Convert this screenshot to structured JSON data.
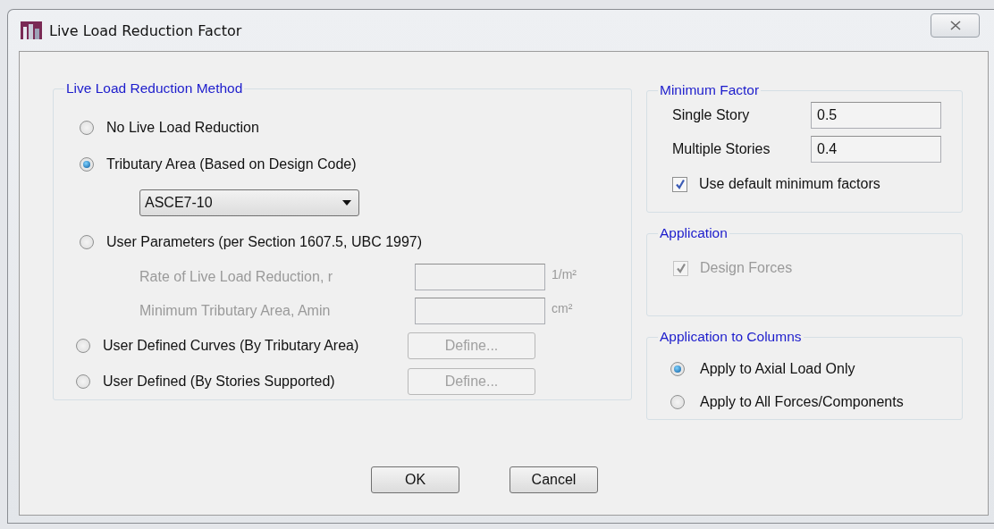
{
  "window": {
    "title": "Live Load Reduction Factor"
  },
  "method": {
    "title": "Live Load Reduction Method",
    "items": [
      {
        "kind": "radio",
        "label": "No Live Load Reduction",
        "selected": false
      },
      {
        "kind": "radio",
        "label": "Tributary Area (Based on Design Code)",
        "selected": true
      },
      {
        "kind": "dropdown",
        "value": "ASCE7-10"
      },
      {
        "kind": "radio",
        "label": "User Parameters (per Section 1607.5, UBC 1997)",
        "selected": false
      },
      {
        "kind": "param",
        "label": "Rate of Live Load Reduction, r",
        "unit": "1/m²",
        "disabled": true
      },
      {
        "kind": "param",
        "label": "Minimum Tributary Area, Amin",
        "unit": "cm²",
        "disabled": true
      },
      {
        "kind": "radio",
        "label": "User Defined Curves (By Tributary Area)",
        "selected": false,
        "button": {
          "label": "Define...",
          "disabled": true
        }
      },
      {
        "kind": "radio",
        "label": "User Defined (By Stories Supported)",
        "selected": false,
        "button": {
          "label": "Define...",
          "disabled": true
        }
      }
    ]
  },
  "minimum_factor": {
    "title": "Minimum Factor",
    "fields": [
      {
        "label": "Single Story",
        "value": "0.5"
      },
      {
        "label": "Multiple Stories",
        "value": "0.4"
      }
    ],
    "checkbox": {
      "label": "Use default minimum factors",
      "checked": true,
      "disabled": false
    }
  },
  "application": {
    "title": "Application",
    "checkbox": {
      "label": "Design Forces",
      "checked": true,
      "disabled": true
    }
  },
  "application_to_columns": {
    "title": "Application to Columns",
    "options": [
      {
        "label": "Apply to Axial Load Only",
        "selected": true
      },
      {
        "label": "Apply to All Forces/Components",
        "selected": false
      }
    ]
  },
  "buttons": [
    "OK",
    "Cancel"
  ]
}
